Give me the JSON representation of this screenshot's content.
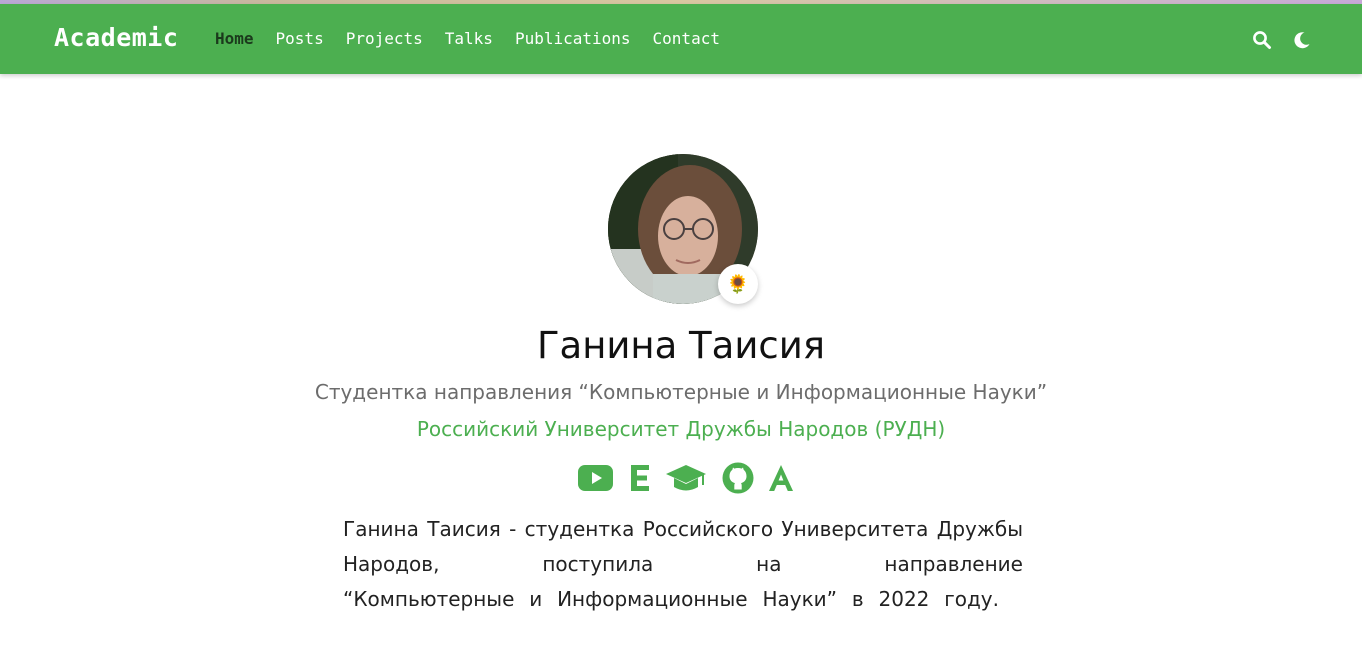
{
  "navbar": {
    "brand": "Academic",
    "links": [
      "Home",
      "Posts",
      "Projects",
      "Talks",
      "Publications",
      "Contact"
    ],
    "active_index": 0,
    "icons": [
      "search-icon",
      "moon-icon"
    ],
    "color": "#4caf50"
  },
  "profile": {
    "name": "Ганина Таисия",
    "role": "Студентка направления “Компьютерные и Информационные Науки”",
    "organization": "Российский Университет Дружбы Народов (РУДН)",
    "status_emoji": "🌻",
    "social_icons": [
      "youtube-icon",
      "e-icon",
      "graduation-cap-icon",
      "github-icon",
      "a-icon"
    ]
  },
  "bio": {
    "lines": [
      "Ганина Таисия - студентка Российского Университета Дружбы Народов, поступила на направление",
      "“Компьютерные и Информационные Науки” в 2022 году."
    ]
  },
  "colors": {
    "accent": "#4caf50",
    "text": "#222222",
    "muted": "#6c6c6c"
  }
}
